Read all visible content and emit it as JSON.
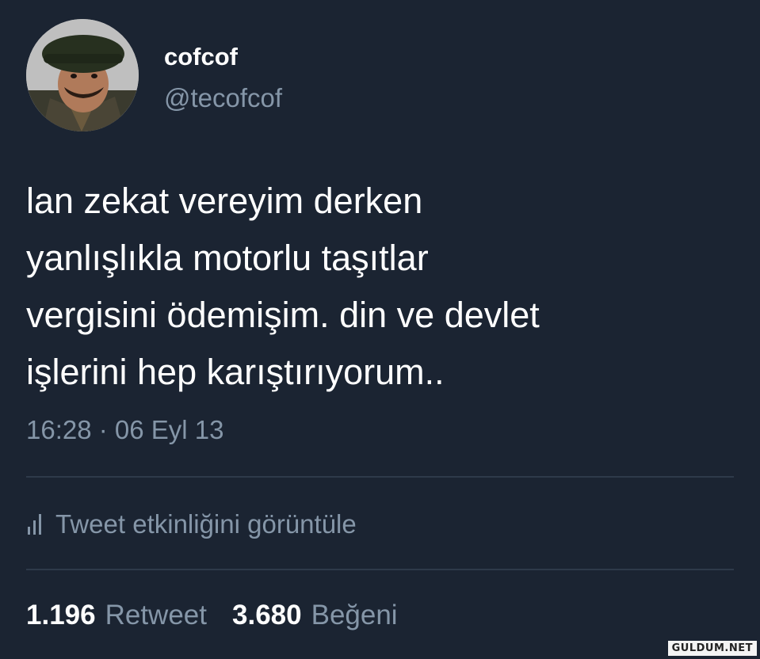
{
  "author": {
    "display_name": "cofcof",
    "handle": "@tecofcof"
  },
  "tweet": {
    "lines": [
      "lan zekat vereyim derken",
      "yanlışlıkla motorlu taşıtlar",
      "vergisini ödemişim. din ve devlet",
      "işlerini hep karıştırıyorum.."
    ],
    "timestamp": "16:28 · 06 Eyl 13"
  },
  "activity": {
    "icon": "bar-chart-icon",
    "label": "Tweet etkinliğini görüntüle"
  },
  "stats": {
    "retweet_count": "1.196",
    "retweet_label": "Retweet",
    "like_count": "3.680",
    "like_label": "Beğeni"
  },
  "watermark": "GULDUM.NET",
  "colors": {
    "background": "#1b2432",
    "text_primary": "#ffffff",
    "text_secondary": "#8596a8",
    "divider": "#2e3a4a"
  }
}
